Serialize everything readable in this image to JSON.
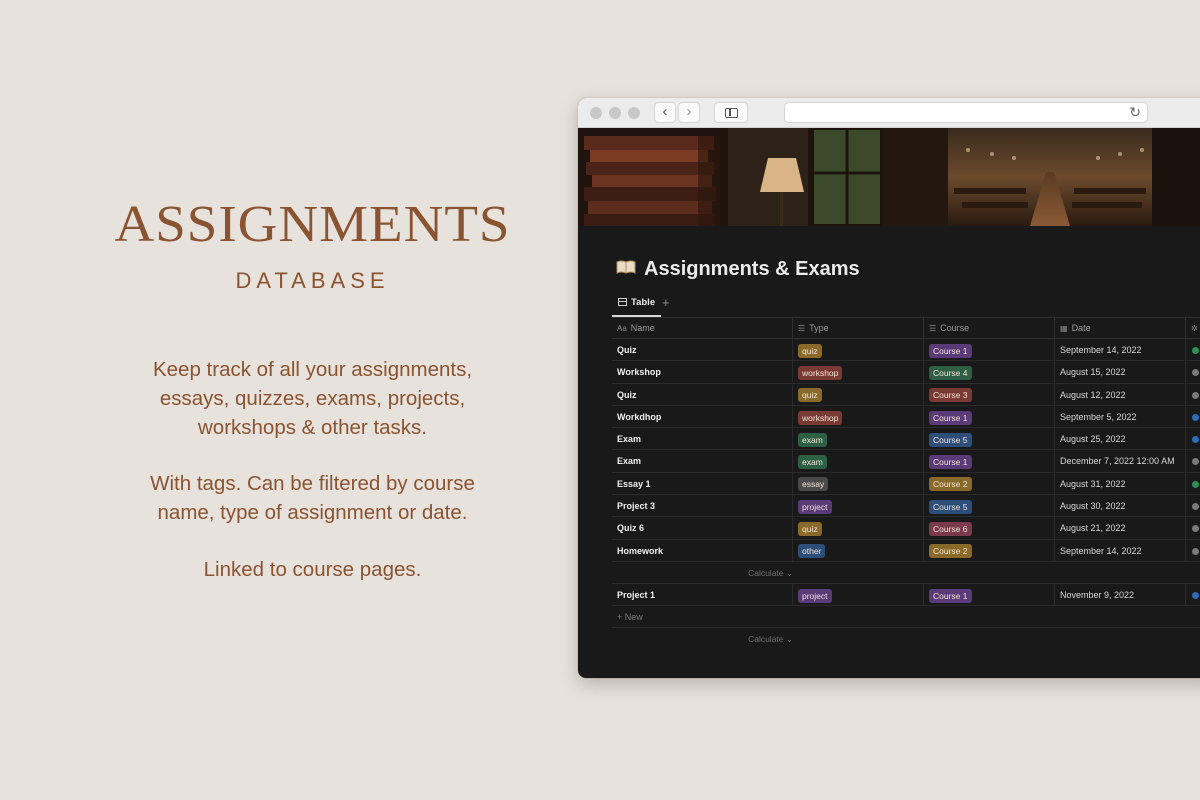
{
  "promo": {
    "title": "ASSIGNMENTS",
    "subtitle": "DATABASE",
    "para1": [
      "Keep track of all your assignments,",
      "essays, quizzes, exams, projects,",
      "workshops & other tasks."
    ],
    "para2": [
      "With tags. Can be filtered by course",
      "name, type of assignment or date."
    ],
    "para3": [
      "Linked to course pages."
    ],
    "color": "#8a5331"
  },
  "browser": {
    "back_icon": "chevron-left-icon",
    "forward_icon": "chevron-right-icon",
    "sidebar_icon": "sidebar-icon",
    "reload_icon": "reload-icon"
  },
  "page": {
    "icon": "open-book-icon",
    "title": "Assignments & Exams",
    "view_tab": "Table",
    "add_view": "+"
  },
  "table": {
    "columns": [
      {
        "label": "Name",
        "icon": "Aa"
      },
      {
        "label": "Type",
        "icon": "☰"
      },
      {
        "label": "Course",
        "icon": "☰"
      },
      {
        "label": "Date",
        "icon": "▦"
      },
      {
        "label": "",
        "icon": "✲"
      }
    ],
    "rows": [
      {
        "name": "Quiz",
        "type": "quiz",
        "course": "Course 1",
        "date": "September 14, 2022",
        "status_color": "#2f8f55"
      },
      {
        "name": "Workshop",
        "type": "workshop",
        "course": "Course 4",
        "date": "August 15, 2022",
        "status_color": "#7a7a7a"
      },
      {
        "name": "Quiz",
        "type": "quiz",
        "course": "Course 3",
        "date": "August 12, 2022",
        "status_color": "#7a7a7a"
      },
      {
        "name": "Workdhop",
        "type": "workshop",
        "course": "Course 1",
        "date": "September 5, 2022",
        "status_color": "#2e6bb8"
      },
      {
        "name": "Exam",
        "type": "exam",
        "course": "Course 5",
        "date": "August 25, 2022",
        "status_color": "#2e6bb8"
      },
      {
        "name": "Exam",
        "type": "exam",
        "course": "Course 1",
        "date": "December 7, 2022 12:00 AM",
        "status_color": "#7a7a7a"
      },
      {
        "name": "Essay 1",
        "type": "essay",
        "course": "Course 2",
        "date": "August 31, 2022",
        "status_color": "#2f8f55"
      },
      {
        "name": "Project 3",
        "type": "project",
        "course": "Course 5",
        "date": "August 30, 2022",
        "status_color": "#7a7a7a"
      },
      {
        "name": "Quiz 6",
        "type": "quiz",
        "course": "Course 6",
        "date": "August 21, 2022",
        "status_color": "#7a7a7a"
      },
      {
        "name": "Homework",
        "type": "other",
        "course": "Course 2",
        "date": "September 14, 2022",
        "status_color": "#7a7a7a"
      }
    ],
    "calculate_label": "Calculate ⌄",
    "extra_row": {
      "name": "Project 1",
      "type": "project",
      "course": "Course 1",
      "date": "November 9, 2022",
      "status_color": "#2e6bb8"
    },
    "new_label": "+ New",
    "calculate_label_2": "Calculate ⌄"
  },
  "tag_colors": {
    "quiz": "#8a6a2a",
    "workshop": "#7a3a34",
    "exam": "#2e5e44",
    "essay": "#4a4a4a",
    "project": "#5b3a78",
    "other": "#2d4e78",
    "Course 1": "#5b3a78",
    "Course 2": "#8a6a2a",
    "Course 3": "#7a3a34",
    "Course 4": "#2e5e44",
    "Course 5": "#2d4e78",
    "Course 6": "#7a3a4e"
  }
}
